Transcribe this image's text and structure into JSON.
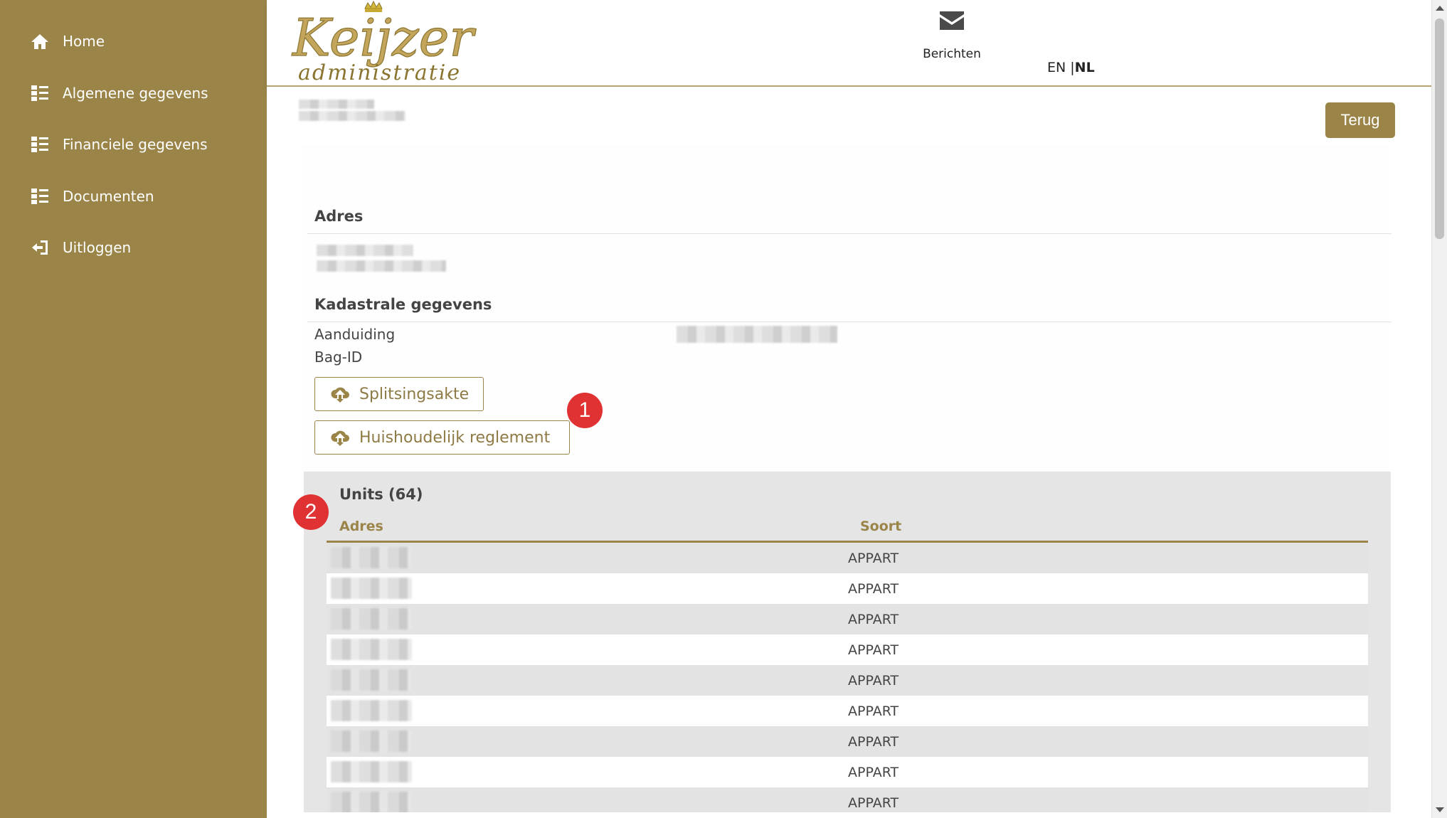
{
  "sidebar": {
    "items": [
      {
        "label": "Home",
        "icon": "home-icon"
      },
      {
        "label": "Algemene gegevens",
        "icon": "list-icon"
      },
      {
        "label": "Financiele gegevens",
        "icon": "list-icon"
      },
      {
        "label": "Documenten",
        "icon": "list-icon"
      },
      {
        "label": "Uitloggen",
        "icon": "logout-icon"
      }
    ]
  },
  "header": {
    "logo_text": "Keijzer",
    "logo_subtext": "administratie",
    "messages_label": "Berichten",
    "lang_en": "EN",
    "lang_sep": " |",
    "lang_nl": "NL"
  },
  "main": {
    "back_label": "Terug",
    "address_title": "Adres",
    "cadastral_title": "Kadastrale gegevens",
    "designation_label": "Aanduiding",
    "bag_label": "Bag-ID",
    "btn_deed": "Splitsingsakte",
    "btn_rules": "Huishoudelijk reglement",
    "badge_1": "1",
    "badge_2": "2"
  },
  "units": {
    "title": "Units (64)",
    "col_address": "Adres",
    "col_type": "Soort",
    "rows": [
      "APPART",
      "APPART",
      "APPART",
      "APPART",
      "APPART",
      "APPART",
      "APPART",
      "APPART",
      "APPART"
    ]
  },
  "colors": {
    "brand": "#9a8448",
    "badge": "#e03232"
  }
}
